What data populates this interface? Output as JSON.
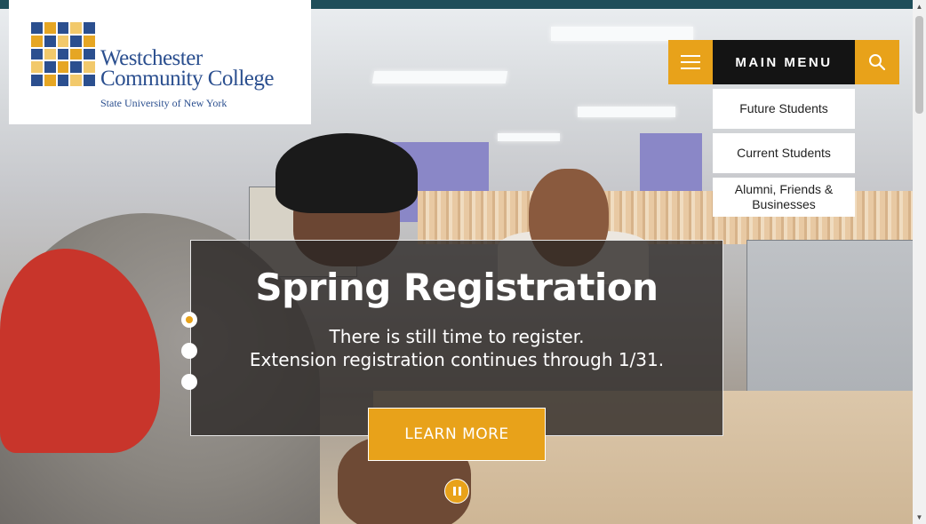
{
  "logo": {
    "line1": "Westchester",
    "line2": "Community College",
    "subtitle": "State University of New York"
  },
  "menu": {
    "label": "MAIN MENU",
    "audience_links": [
      {
        "label": "Future Students"
      },
      {
        "label": "Current Students"
      },
      {
        "label": "Alumni, Friends & Businesses"
      }
    ]
  },
  "slide": {
    "title": "Spring Registration",
    "line1": "There is still time to register.",
    "line2": "Extension registration continues through 1/31.",
    "button": "LEARN MORE",
    "dots_count": 3,
    "active_dot": 1
  },
  "icons": {
    "hamburger": "hamburger-icon",
    "search": "search-icon",
    "pause": "pause-icon"
  },
  "colors": {
    "accent": "#e8a21a",
    "brand_blue": "#2b4f8f",
    "menu_dark": "#141414",
    "top_bar": "#1f4e5a"
  }
}
